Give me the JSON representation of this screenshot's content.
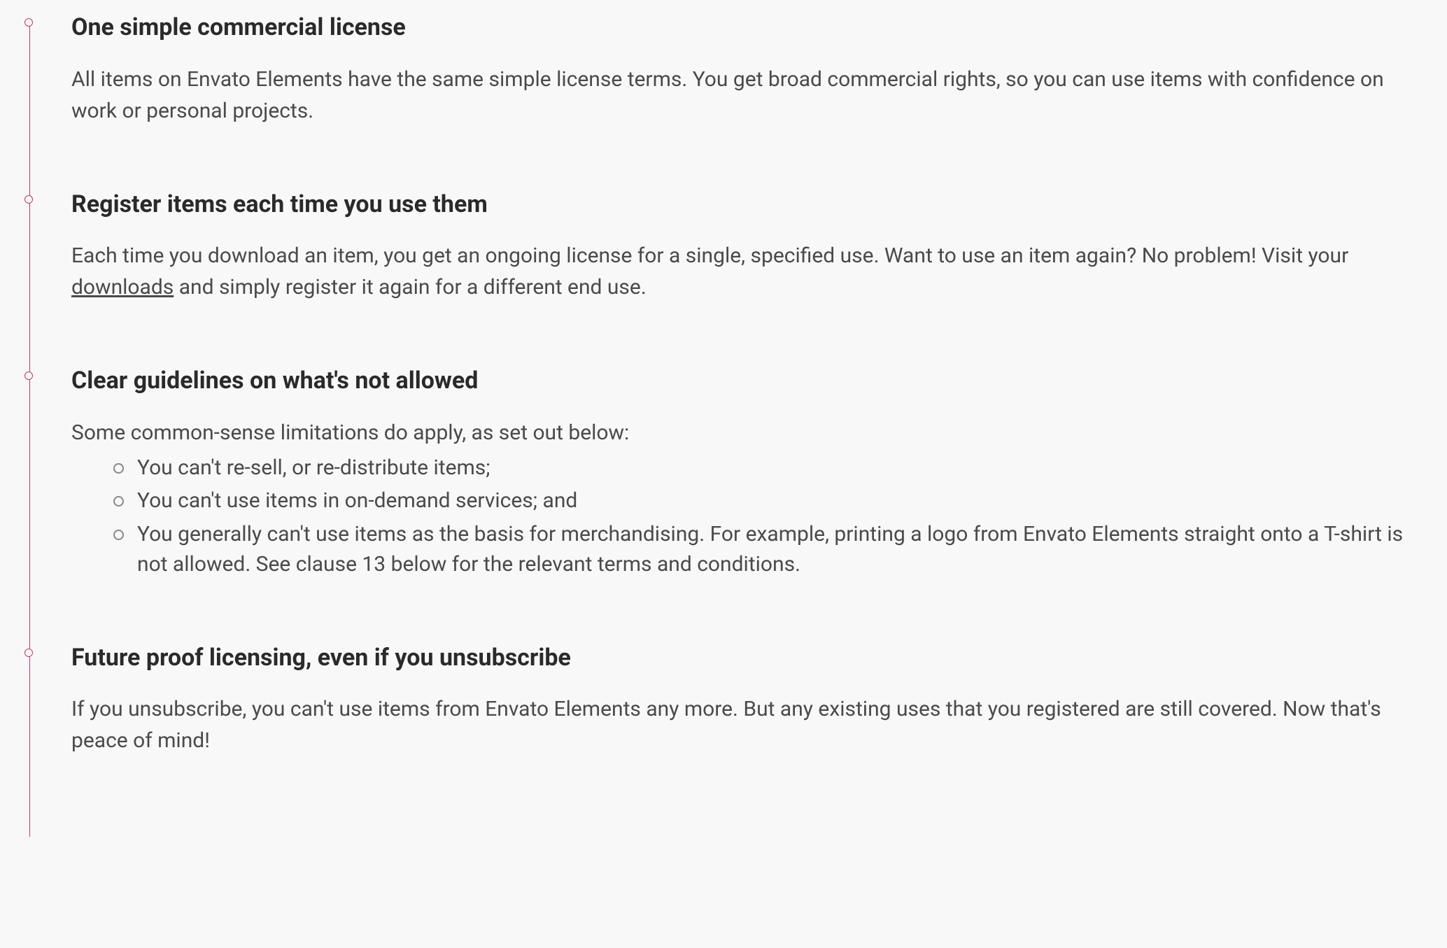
{
  "sections": [
    {
      "heading": "One simple commercial license",
      "body": "All items on Envato Elements have the same simple license terms. You get broad commercial rights, so you can use items with confidence on work or personal projects."
    },
    {
      "heading": "Register items each time you use them",
      "body_parts": {
        "before": "Each time you download an item, you get an ongoing license for a single, specified use. Want to use an item again? No problem! Visit your ",
        "link": "downloads",
        "after": " and simply register it again for a different end use."
      }
    },
    {
      "heading": "Clear guidelines on what's not allowed",
      "intro": "Some common-sense limitations do apply, as set out below:",
      "items": [
        "You can't re-sell, or re-distribute items;",
        "You can't use items in on-demand services; and",
        "You generally can't use items as the basis for merchandising. For example, printing a logo from Envato Elements straight onto a T-shirt is not allowed. See clause 13 below for the relevant terms and conditions."
      ]
    },
    {
      "heading": "Future proof licensing, even if you unsubscribe",
      "body": "If you unsubscribe, you can't use items from Envato Elements any more. But any existing uses that you registered are still covered. Now that's peace of mind!"
    }
  ]
}
